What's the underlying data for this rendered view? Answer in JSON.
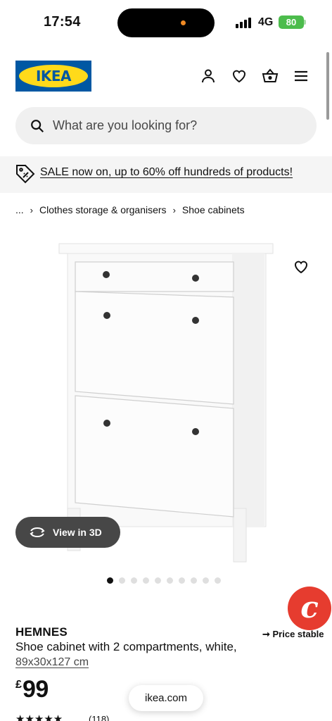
{
  "status_bar": {
    "time": "17:54",
    "network": "4G",
    "battery": "80"
  },
  "header": {
    "logo_text": "IKEA",
    "icons": [
      "account-icon",
      "heart-icon",
      "basket-icon",
      "menu-icon"
    ]
  },
  "search": {
    "placeholder": "What are you looking for?"
  },
  "banner": {
    "text": "SALE now on, up to 60% off hundreds of products!"
  },
  "breadcrumb": {
    "ellipsis": "...",
    "items": [
      "Clothes storage & organisers",
      "Shoe cabinets"
    ]
  },
  "gallery": {
    "view_3d_label": "View in 3D",
    "image_count": 10,
    "active_index": 0
  },
  "product": {
    "name": "HEMNES",
    "description": "Shoe cabinet with 2 compartments, white,",
    "dimensions": "89x30x127 cm",
    "price_currency": "£",
    "price_value": "99",
    "price_status": "Price stable",
    "rating_stars": "★★★★★",
    "review_count": "(118)"
  },
  "browser": {
    "url": "ikea.com"
  },
  "colors": {
    "ikea_blue": "#0058a3",
    "ikea_yellow": "#ffda1a",
    "battery_green": "#4cbc4c",
    "fab_red": "#e63c2f"
  }
}
